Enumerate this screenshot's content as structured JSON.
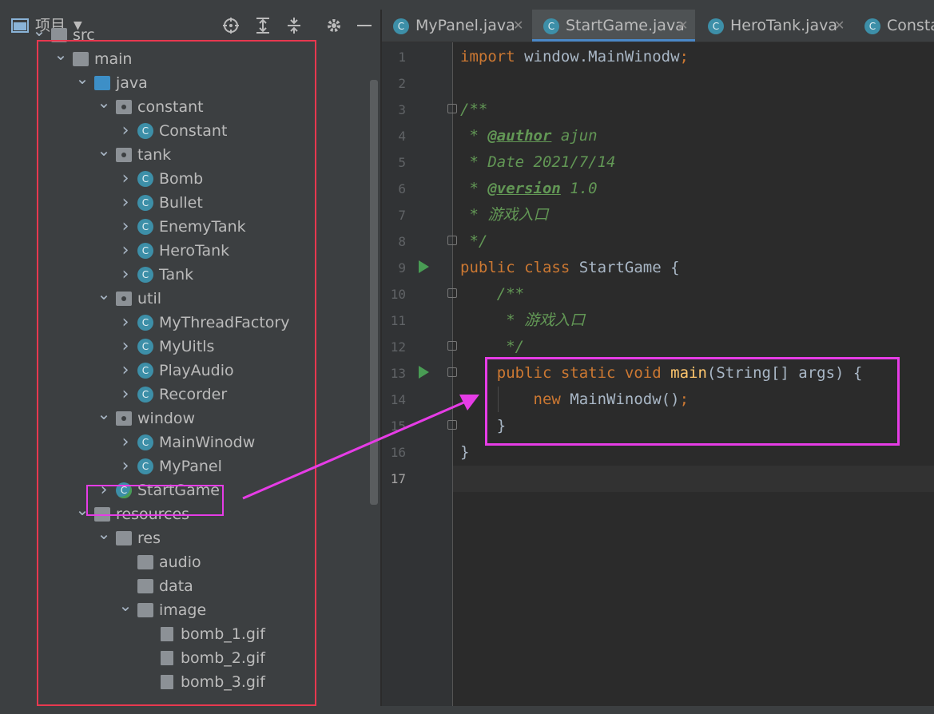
{
  "project_panel": {
    "title": "项目",
    "tree": [
      {
        "label": "src",
        "depth": 0,
        "kind": "folder",
        "expanded": true
      },
      {
        "label": "main",
        "depth": 1,
        "kind": "folder",
        "expanded": true
      },
      {
        "label": "java",
        "depth": 2,
        "kind": "source-folder",
        "expanded": true
      },
      {
        "label": "constant",
        "depth": 3,
        "kind": "package",
        "expanded": true
      },
      {
        "label": "Constant",
        "depth": 4,
        "kind": "class",
        "expanded": false
      },
      {
        "label": "tank",
        "depth": 3,
        "kind": "package",
        "expanded": true
      },
      {
        "label": "Bomb",
        "depth": 4,
        "kind": "class",
        "expanded": false
      },
      {
        "label": "Bullet",
        "depth": 4,
        "kind": "class",
        "expanded": false
      },
      {
        "label": "EnemyTank",
        "depth": 4,
        "kind": "class",
        "expanded": false
      },
      {
        "label": "HeroTank",
        "depth": 4,
        "kind": "class",
        "expanded": false
      },
      {
        "label": "Tank",
        "depth": 4,
        "kind": "abstract-class",
        "expanded": false
      },
      {
        "label": "util",
        "depth": 3,
        "kind": "package",
        "expanded": true
      },
      {
        "label": "MyThreadFactory",
        "depth": 4,
        "kind": "class",
        "expanded": false
      },
      {
        "label": "MyUitls",
        "depth": 4,
        "kind": "class",
        "expanded": false
      },
      {
        "label": "PlayAudio",
        "depth": 4,
        "kind": "class",
        "expanded": false
      },
      {
        "label": "Recorder",
        "depth": 4,
        "kind": "class",
        "expanded": false
      },
      {
        "label": "window",
        "depth": 3,
        "kind": "package",
        "expanded": true
      },
      {
        "label": "MainWinodw",
        "depth": 4,
        "kind": "class",
        "expanded": false
      },
      {
        "label": "MyPanel",
        "depth": 4,
        "kind": "class",
        "expanded": false
      },
      {
        "label": "StartGame",
        "depth": 3,
        "kind": "main-class",
        "expanded": false
      },
      {
        "label": "resources",
        "depth": 2,
        "kind": "resources-folder",
        "expanded": true
      },
      {
        "label": "res",
        "depth": 3,
        "kind": "folder",
        "expanded": true
      },
      {
        "label": "audio",
        "depth": 4,
        "kind": "folder",
        "leaf": true
      },
      {
        "label": "data",
        "depth": 4,
        "kind": "folder",
        "leaf": true
      },
      {
        "label": "image",
        "depth": 4,
        "kind": "folder",
        "expanded": true
      },
      {
        "label": "bomb_1.gif",
        "depth": 5,
        "kind": "gif",
        "leaf": true
      },
      {
        "label": "bomb_2.gif",
        "depth": 5,
        "kind": "gif",
        "leaf": true
      },
      {
        "label": "bomb_3.gif",
        "depth": 5,
        "kind": "gif",
        "leaf": true
      }
    ]
  },
  "tabs": [
    {
      "label": "MyPanel.java",
      "active": false
    },
    {
      "label": "StartGame.java",
      "active": true
    },
    {
      "label": "HeroTank.java",
      "active": false
    },
    {
      "label": "Consta",
      "active": false
    }
  ],
  "editor": {
    "lines": [
      {
        "n": "1",
        "html": "<span class='kw'>import</span> window.MainWinodw<span class='kw'>;</span>"
      },
      {
        "n": "2",
        "html": ""
      },
      {
        "n": "3",
        "html": "<span class='doc'>/**</span>"
      },
      {
        "n": "4",
        "html": "<span class='doc'> * <span class='tag'>@author</span> ajun</span>"
      },
      {
        "n": "5",
        "html": "<span class='doc'> * Date 2021/7/14</span>"
      },
      {
        "n": "6",
        "html": "<span class='doc'> * <span class='tag'>@version</span> 1.0</span>"
      },
      {
        "n": "7",
        "html": "<span class='doc'> * 游戏入口</span>"
      },
      {
        "n": "8",
        "html": "<span class='doc'> */</span>"
      },
      {
        "n": "9",
        "html": "<span class='kw'>public class</span> StartGame {"
      },
      {
        "n": "10",
        "html": "    <span class='doc'>/**</span>"
      },
      {
        "n": "11",
        "html": "<span class='doc'>     * 游戏入口</span>"
      },
      {
        "n": "12",
        "html": "<span class='doc'>     */</span>"
      },
      {
        "n": "13",
        "html": "    <span class='kw'>public static void</span> <span class='fn'>main</span>(String[] args) {"
      },
      {
        "n": "14",
        "html": "        <span class='kw'>new</span> MainWinodw()<span class='kw'>;</span>"
      },
      {
        "n": "15",
        "html": "    }"
      },
      {
        "n": "16",
        "html": "}"
      },
      {
        "n": "17",
        "html": ""
      }
    ]
  },
  "colors": {
    "highlight_red": "#e8384f",
    "highlight_magenta": "#e63ce6",
    "accent": "#4a88c7"
  },
  "icons": {
    "project-view": "window-icon",
    "dropdown": "chevron-down-icon",
    "locate": "crosshair-icon",
    "expand-all": "expand-all-icon",
    "collapse-all": "collapse-all-icon",
    "settings": "gear-icon",
    "hide": "minimize-icon"
  }
}
